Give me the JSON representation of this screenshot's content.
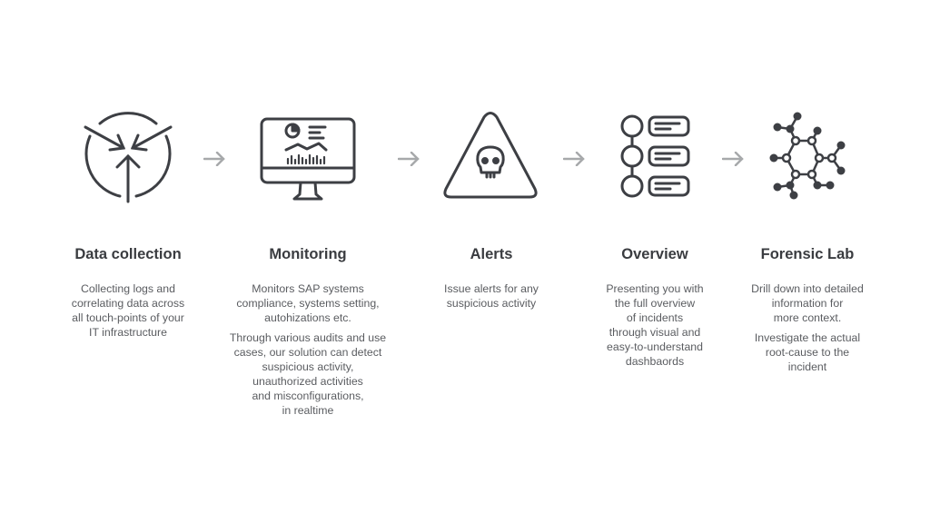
{
  "steps": [
    {
      "title": "Data collection",
      "icon": "converging-arrows-icon",
      "paragraphs": [
        "Collecting logs and\ncorrelating data across\nall touch-points of your\nIT infrastructure"
      ]
    },
    {
      "title": "Monitoring",
      "icon": "monitor-dashboard-icon",
      "paragraphs": [
        "Monitors SAP systems\ncompliance, systems setting,\nautohizations etc.",
        "Through various audits and use\ncases, our solution can detect\nsuspicious activity,\nunauthorized activities\nand misconfigurations,\nin realtime"
      ]
    },
    {
      "title": "Alerts",
      "icon": "warning-skull-icon",
      "paragraphs": [
        "Issue alerts for any\nsuspicious activity"
      ]
    },
    {
      "title": "Overview",
      "icon": "timeline-list-icon",
      "paragraphs": [
        "Presenting you with\nthe full overview\nof incidents\nthrough visual and\neasy-to-understand\ndashbaords"
      ]
    },
    {
      "title": "Forensic Lab",
      "icon": "network-graph-icon",
      "paragraphs": [
        "Drill down into detailed\ninformation for\nmore context.",
        "Investigate the actual\nroot-cause to the\nincident"
      ]
    }
  ],
  "colors": {
    "icon": "#3d3f44",
    "arrow": "#a7a9ab",
    "title": "#3a3c40",
    "text": "#5a5c60"
  }
}
